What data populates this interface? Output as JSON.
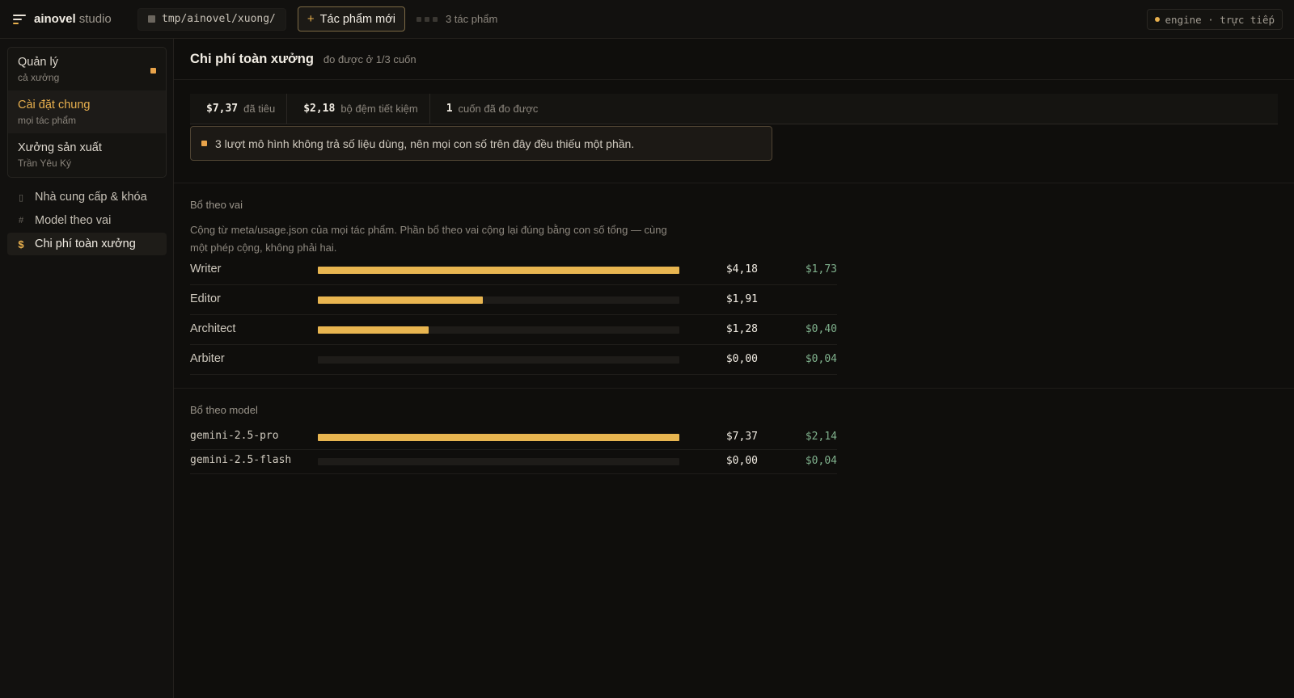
{
  "topbar": {
    "brand_name": "ainovel",
    "brand_sub": "studio",
    "path": "tmp/ainovel/xuong/",
    "new_button": "Tác phẩm mới",
    "work_count": "3 tác phẩm",
    "engine_status": "engine · trực tiếp"
  },
  "sidebar": {
    "scopes": [
      {
        "title": "Quản lý",
        "subtitle": "cả xưởng"
      },
      {
        "title": "Cài đặt chung",
        "subtitle": "mọi tác phẩm"
      },
      {
        "title": "Xưởng sản xuất",
        "subtitle": "Trần Yêu Ký"
      }
    ],
    "nav": [
      {
        "label": "Nhà cung cấp & khóa",
        "icon": "server-icon"
      },
      {
        "label": "Model theo vai",
        "icon": "hash-icon"
      },
      {
        "label": "Chi phí toàn xưởng",
        "icon": "dollar-icon"
      }
    ]
  },
  "main": {
    "title": "Chi phí toàn xưởng",
    "subtitle": "đo được ở 1/3 cuốn",
    "stats": [
      {
        "value": "$7,37",
        "label": "đã tiêu"
      },
      {
        "value": "$2,18",
        "label": "bộ đệm tiết kiệm"
      },
      {
        "value": "1",
        "label": "cuốn đã đo được"
      }
    ],
    "warning": "3 lượt mô hình không trả số liệu dùng, nên mọi con số trên đây đều thiếu một phần.",
    "by_role": {
      "title": "Bổ theo vai",
      "description": "Cộng từ meta/usage.json của mọi tác phẩm. Phần bổ theo vai cộng lại đúng bằng con số tổng — cùng một phép cộng, không phải hai.",
      "rows": [
        {
          "label": "Writer",
          "value": 4.18,
          "cost": "$4,18",
          "saved": "$1,73"
        },
        {
          "label": "Editor",
          "value": 1.91,
          "cost": "$1,91",
          "saved": ""
        },
        {
          "label": "Architect",
          "value": 1.28,
          "cost": "$1,28",
          "saved": "$0,40"
        },
        {
          "label": "Arbiter",
          "value": 0.0,
          "cost": "$0,00",
          "saved": "$0,04"
        }
      ]
    },
    "by_model": {
      "title": "Bổ theo model",
      "rows": [
        {
          "label": "gemini-2.5-pro",
          "value": 7.37,
          "cost": "$7,37",
          "saved": "$2,14"
        },
        {
          "label": "gemini-2.5-flash",
          "value": 0.0,
          "cost": "$0,00",
          "saved": "$0,04"
        }
      ]
    }
  },
  "colors": {
    "accent": "#e8b04e",
    "saved": "#7fb08c",
    "background": "#0f0e0c"
  }
}
